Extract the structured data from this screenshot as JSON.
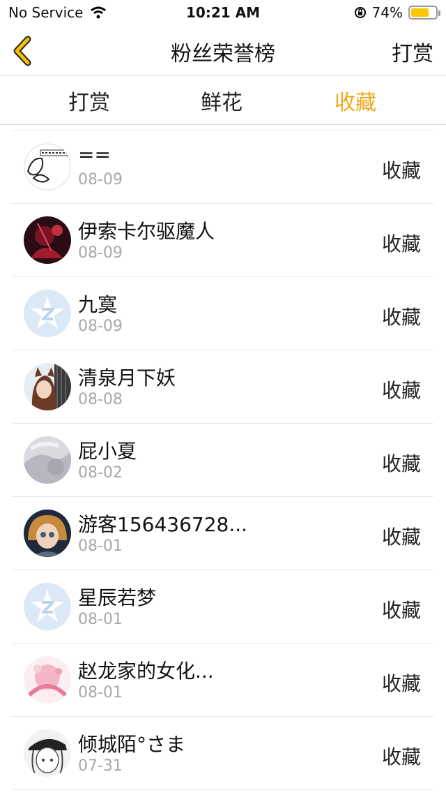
{
  "status": {
    "carrier": "No Service",
    "time": "10:21 AM",
    "battery": "74%",
    "battery_level": 0.74
  },
  "nav": {
    "title": "粉丝荣誉榜",
    "right_label": "打赏"
  },
  "tabs": [
    {
      "label": "打赏",
      "active": false
    },
    {
      "label": "鲜花",
      "active": false
    },
    {
      "label": "收藏",
      "active": true
    }
  ],
  "colors": {
    "accent": "#f0a818",
    "back_arrow": "#f5c000",
    "divider": "#e6e6e6",
    "date": "#a8a8a8"
  },
  "rows": [
    {
      "name": "==",
      "date": "08-09",
      "action": "收藏",
      "avatar": "sketch-avatar"
    },
    {
      "name": "伊索卡尔驱魔人",
      "date": "08-09",
      "action": "收藏",
      "avatar": "dark-red-avatar"
    },
    {
      "name": "九寞",
      "date": "08-09",
      "action": "收藏",
      "avatar": "default-z-avatar"
    },
    {
      "name": "清泉月下妖",
      "date": "08-08",
      "action": "收藏",
      "avatar": "anime-girl-avatar"
    },
    {
      "name": "屁小夏",
      "date": "08-02",
      "action": "收藏",
      "avatar": "gray-avatar"
    },
    {
      "name": "游客156436728...",
      "date": "08-01",
      "action": "收藏",
      "avatar": "doll-avatar"
    },
    {
      "name": "星辰若梦",
      "date": "08-01",
      "action": "收藏",
      "avatar": "default-z-avatar"
    },
    {
      "name": "赵龙家的女化...",
      "date": "08-01",
      "action": "收藏",
      "avatar": "pink-avatar"
    },
    {
      "name": "倾城陌°さま",
      "date": "07-31",
      "action": "收藏",
      "avatar": "manga-avatar"
    }
  ]
}
